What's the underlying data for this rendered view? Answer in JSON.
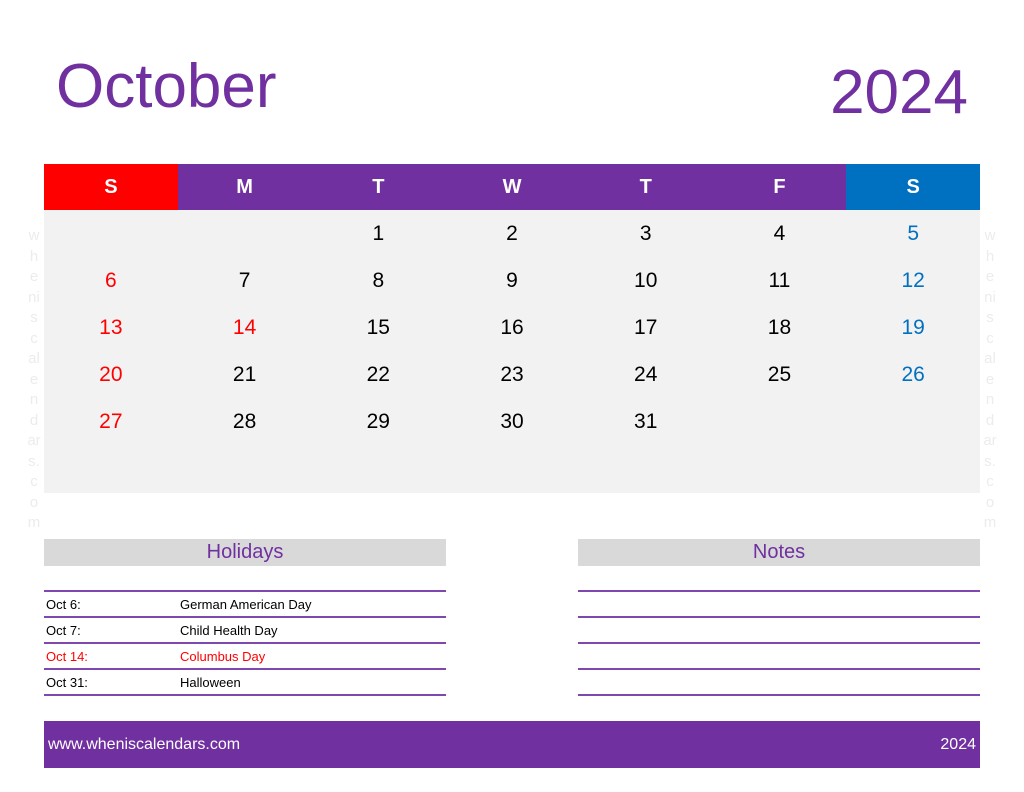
{
  "header": {
    "month": "October",
    "year": "2024"
  },
  "colors": {
    "accent": "#7030a0",
    "sunday": "#ff0000",
    "saturday": "#0070c0",
    "grid_bg": "#f2f2f2",
    "panel_header_bg": "#d9d9d9"
  },
  "weekdays": [
    "S",
    "M",
    "T",
    "W",
    "T",
    "F",
    "S"
  ],
  "weeks": [
    [
      "",
      "",
      "1",
      "2",
      "3",
      "4",
      "5"
    ],
    [
      "6",
      "7",
      "8",
      "9",
      "10",
      "11",
      "12"
    ],
    [
      "13",
      "14",
      "15",
      "16",
      "17",
      "18",
      "19"
    ],
    [
      "20",
      "21",
      "22",
      "23",
      "24",
      "25",
      "26"
    ],
    [
      "27",
      "28",
      "29",
      "30",
      "31",
      "",
      ""
    ]
  ],
  "highlighted_days": [
    "14"
  ],
  "watermark": [
    "w",
    "h",
    "e",
    "ni",
    "s",
    "c",
    "al",
    "e",
    "n",
    "d",
    "ar",
    "s.",
    "c",
    "o",
    "m"
  ],
  "holidays": {
    "title": "Holidays",
    "items": [
      {
        "date": "Oct 6:",
        "name": "German American Day",
        "highlight": false
      },
      {
        "date": "Oct 7:",
        "name": "Child Health Day",
        "highlight": false
      },
      {
        "date": "Oct 14:",
        "name": "Columbus Day",
        "highlight": true
      },
      {
        "date": "Oct 31:",
        "name": "Halloween",
        "highlight": false
      }
    ]
  },
  "notes": {
    "title": "Notes",
    "line_count": 4
  },
  "footer": {
    "website": "www.wheniscalendars.com",
    "year": "2024"
  }
}
